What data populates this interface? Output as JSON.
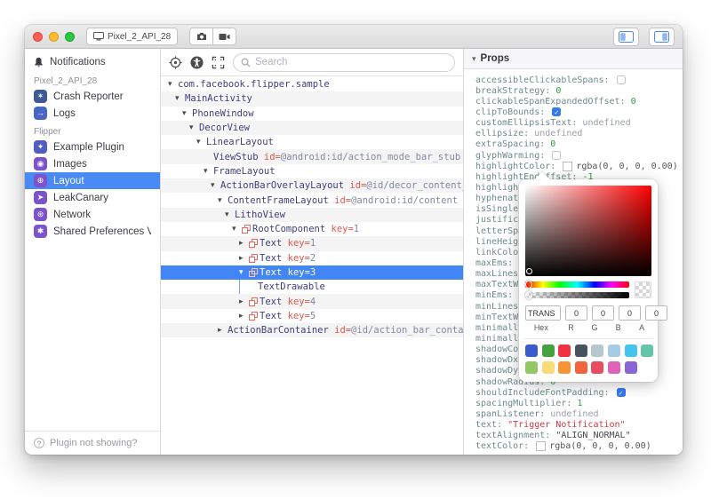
{
  "titlebar": {
    "device_button": "Pixel_2_API_28"
  },
  "sidebar": {
    "notifications_label": "Notifications",
    "sections": [
      {
        "label": "Pixel_2_API_28",
        "items": [
          {
            "label": "Crash Reporter",
            "icon": "crash-reporter",
            "glyph": "✶",
            "color": "#3d5a96",
            "selected": false
          },
          {
            "label": "Logs",
            "icon": "logs",
            "glyph": "→",
            "color": "#4867c3",
            "selected": false
          }
        ]
      },
      {
        "label": "Flipper",
        "items": [
          {
            "label": "Example Plugin",
            "icon": "example-plugin",
            "glyph": "✦",
            "color": "#525dc0",
            "selected": false
          },
          {
            "label": "Images",
            "icon": "images",
            "glyph": "◉",
            "color": "#7d53c9",
            "selected": false
          },
          {
            "label": "Layout",
            "icon": "layout",
            "glyph": "⊕",
            "color": "#7d53c9",
            "selected": true
          },
          {
            "label": "LeakCanary",
            "icon": "leakcanary",
            "glyph": "➤",
            "color": "#7d53c9",
            "selected": false
          },
          {
            "label": "Network",
            "icon": "network",
            "glyph": "⊛",
            "color": "#7d53c9",
            "selected": false
          },
          {
            "label": "Shared Preferences Viewer",
            "icon": "shared-preferences",
            "glyph": "✱",
            "color": "#7d53c9",
            "selected": false
          }
        ]
      }
    ],
    "footer": "Plugin not showing?"
  },
  "toolbar": {
    "search_placeholder": "Search"
  },
  "tree": {
    "nodes": [
      {
        "level": 0,
        "arrow": "open",
        "name": "com.facebook.flipper.sample"
      },
      {
        "level": 1,
        "arrow": "open",
        "name": "MainActivity"
      },
      {
        "level": 2,
        "arrow": "open",
        "name": "PhoneWindow"
      },
      {
        "level": 3,
        "arrow": "open",
        "name": "DecorView"
      },
      {
        "level": 4,
        "arrow": "open",
        "name": "LinearLayout"
      },
      {
        "level": 5,
        "arrow": "none",
        "name": "ViewStub",
        "attr": "id",
        "value": "@android:id/action_mode_bar_stub"
      },
      {
        "level": 5,
        "arrow": "open",
        "name": "FrameLayout"
      },
      {
        "level": 6,
        "arrow": "open",
        "name": "ActionBarOverlayLayout",
        "attr": "id",
        "value": "@id/decor_content_parent"
      },
      {
        "level": 7,
        "arrow": "open",
        "name": "ContentFrameLayout",
        "attr": "id",
        "value": "@android:id/content"
      },
      {
        "level": 8,
        "arrow": "open",
        "name": "LithoView"
      },
      {
        "level": 9,
        "arrow": "open",
        "litho": true,
        "name": "RootComponent",
        "attr": "key",
        "value": "1"
      },
      {
        "level": 10,
        "arrow": "closed",
        "litho": true,
        "name": "Text",
        "attr": "key",
        "value": "1"
      },
      {
        "level": 10,
        "arrow": "closed",
        "litho": true,
        "name": "Text",
        "attr": "key",
        "value": "2"
      },
      {
        "level": 10,
        "arrow": "open",
        "litho": true,
        "name": "Text",
        "attr": "key",
        "value": "3",
        "selected": true
      },
      {
        "level": 11,
        "arrow": "none",
        "name": "TextDrawable",
        "guide": true
      },
      {
        "level": 10,
        "arrow": "closed",
        "litho": true,
        "name": "Text",
        "attr": "key",
        "value": "4"
      },
      {
        "level": 10,
        "arrow": "closed",
        "litho": true,
        "name": "Text",
        "attr": "key",
        "value": "5"
      },
      {
        "level": 7,
        "arrow": "closed",
        "name": "ActionBarContainer",
        "attr": "id",
        "value": "@id/action_bar_container"
      }
    ]
  },
  "props": {
    "title": "Props",
    "rows": [
      {
        "name": "accessibleClickableSpans",
        "type": "checkbox",
        "checked": false
      },
      {
        "name": "breakStrategy",
        "type": "number",
        "value": "0"
      },
      {
        "name": "clickableSpanExpandedOffset",
        "type": "number",
        "value": "0"
      },
      {
        "name": "clipToBounds",
        "type": "checkbox",
        "checked": true
      },
      {
        "name": "customEllipsisText",
        "type": "undefined",
        "value": "undefined"
      },
      {
        "name": "ellipsize",
        "type": "undefined",
        "value": "undefined"
      },
      {
        "name": "extraSpacing",
        "type": "number",
        "value": "0"
      },
      {
        "name": "glyphWarming",
        "type": "checkbox",
        "checked": false
      },
      {
        "name": "highlightColor",
        "type": "color",
        "value": "rgba(0, 0, 0, 0.00)"
      },
      {
        "name": "highlightEndOffset",
        "type": "number",
        "value": "-1"
      },
      {
        "name": "highlightStartOffset",
        "type": "hidden",
        "value": ""
      },
      {
        "name": "hyphenationFrequency",
        "type": "hidden",
        "value": ""
      },
      {
        "name": "isSingleLine",
        "type": "hidden",
        "value": ""
      },
      {
        "name": "justificationMode",
        "type": "hidden",
        "value": ""
      },
      {
        "name": "letterSpacing",
        "type": "hidden",
        "value": ""
      },
      {
        "name": "lineHeight",
        "type": "hidden",
        "value": ""
      },
      {
        "name": "linkColor",
        "type": "hidden",
        "value": ""
      },
      {
        "name": "maxEms",
        "type": "number",
        "value": "-1"
      },
      {
        "name": "maxLines",
        "type": "hidden",
        "value": ""
      },
      {
        "name": "maxTextWidth",
        "type": "hidden",
        "value": ""
      },
      {
        "name": "minEms",
        "type": "number",
        "value": "-1"
      },
      {
        "name": "minLines",
        "type": "hidden",
        "value": ""
      },
      {
        "name": "minTextWidth",
        "type": "hidden",
        "value": ""
      },
      {
        "name": "minimallyWide",
        "type": "hidden",
        "value": ""
      },
      {
        "name": "minimallyWideThreshold",
        "type": "hidden",
        "value": ""
      },
      {
        "name": "shadowColor",
        "type": "hidden",
        "value": ""
      },
      {
        "name": "shadowDx",
        "type": "hidden",
        "value": ""
      },
      {
        "name": "shadowDy",
        "type": "hidden",
        "value": ""
      },
      {
        "name": "shadowRadius",
        "type": "number",
        "value": "0"
      },
      {
        "name": "shouldIncludeFontPadding",
        "type": "checkbox",
        "checked": true
      },
      {
        "name": "spacingMultiplier",
        "type": "number",
        "value": "1"
      },
      {
        "name": "spanListener",
        "type": "undefined",
        "value": "undefined"
      },
      {
        "name": "text",
        "type": "string",
        "value": "Trigger Notification"
      },
      {
        "name": "textAlignment",
        "type": "enum",
        "value": "ALIGN_NORMAL"
      },
      {
        "name": "textColor",
        "type": "color",
        "value": "rgba(0, 0, 0, 0.00)"
      }
    ]
  },
  "picker": {
    "hex": "TRANS",
    "r": "0",
    "g": "0",
    "b": "0",
    "a": "0",
    "labels": {
      "hex": "Hex",
      "r": "R",
      "g": "G",
      "b": "B",
      "a": "A"
    },
    "swatches": [
      "#3b5bcc",
      "#44a340",
      "#ee3341",
      "#49525f",
      "#b7c7cf",
      "#a5cbe5",
      "#45c4ee",
      "#63c6aa",
      "#93c763",
      "#f8dc7a",
      "#f59432",
      "#f2643d",
      "#e84c63",
      "#df63b8",
      "#8a65d6"
    ]
  },
  "colors": {
    "selection_blue": "#4285f4",
    "sidebar_selection": "#4a8af5",
    "attr_red": "#e2574b",
    "prop_name_teal": "#6e8b89",
    "number_green": "#2f9e44",
    "string_red": "#cf3745"
  }
}
